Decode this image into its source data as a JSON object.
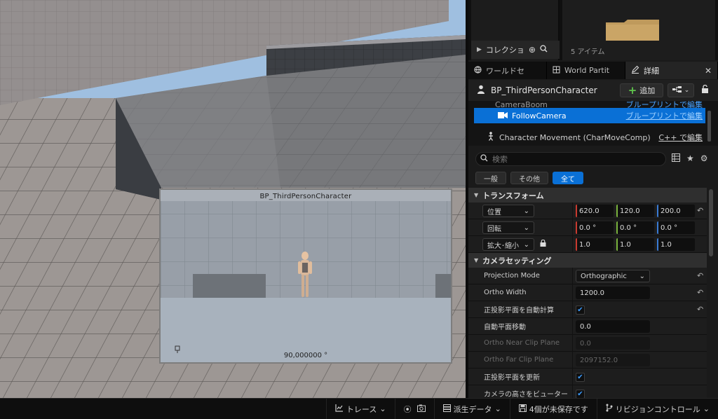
{
  "viewport": {
    "preview": {
      "title": "BP_ThirdPersonCharacter",
      "fov": "90,000000 °"
    }
  },
  "content_browser": {
    "collections_label": "コレクショ",
    "item_count": "5 アイテム"
  },
  "tabs": [
    {
      "label": "ワールドセ",
      "icon": "globe-icon"
    },
    {
      "label": "World Partit",
      "icon": "grid-icon"
    },
    {
      "label": "詳細",
      "icon": "pencil-icon"
    }
  ],
  "actor": {
    "name": "BP_ThirdPersonCharacter",
    "add_label": "追加"
  },
  "components": {
    "partial_label": "CameraBoom",
    "partial_link": "ブループリントで編集",
    "selected": {
      "name": "FollowCamera",
      "link": "ブループリントで編集"
    },
    "movement": {
      "name": "Character Movement (CharMoveComp)",
      "link": "C++ で編集"
    }
  },
  "search": {
    "placeholder": "検索"
  },
  "filters": [
    "一般",
    "その他",
    "全て"
  ],
  "transform": {
    "section": "トランスフォーム",
    "location_label": "位置",
    "rotation_label": "回転",
    "scale_label": "拡大･縮小",
    "location": [
      "620.0",
      "120.0",
      "200.0"
    ],
    "rotation": [
      "0.0 °",
      "0.0 °",
      "0.0 °"
    ],
    "scale": [
      "1.0",
      "1.0",
      "1.0"
    ]
  },
  "camera": {
    "section": "カメラセッティング",
    "projection_mode_label": "Projection Mode",
    "projection_mode_value": "Orthographic",
    "ortho_width_label": "Ortho Width",
    "ortho_width_value": "1200.0",
    "auto_plane_label": "正投影平面を自動計算",
    "auto_plane_checked": true,
    "auto_plane_shift_label": "自動平面移動",
    "auto_plane_shift_value": "0.0",
    "near_clip_label": "Ortho Near Clip Plane",
    "near_clip_value": "0.0",
    "far_clip_label": "Ortho Far Clip Plane",
    "far_clip_value": "2097152.0",
    "update_plane_label": "正投影平面を更新",
    "update_plane_checked": true,
    "height_label": "カメラの高さをビューター",
    "height_checked": true
  },
  "statusbar": {
    "trace": "トレース",
    "derived_data": "派生データ",
    "unsaved": "4個が未保存です",
    "revision_control": "リビジョンコントロール"
  },
  "colors": {
    "accent": "#0a70d6",
    "link": "#4aa3ff",
    "add_green": "#5fc54c",
    "axis_x": "#c93a2f",
    "axis_y": "#79b33d",
    "axis_z": "#3a7bd5"
  }
}
